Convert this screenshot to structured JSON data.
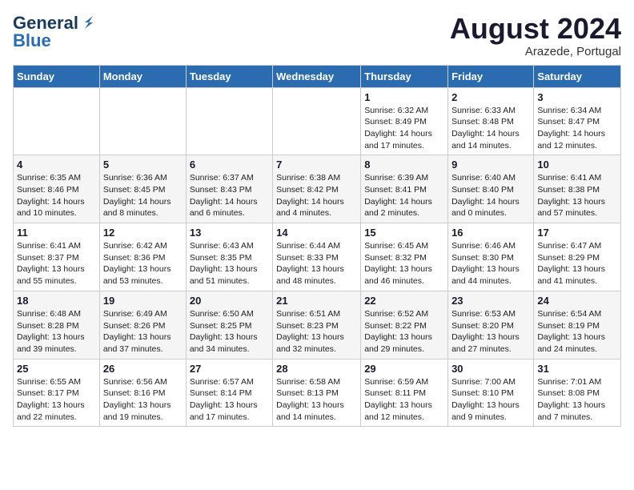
{
  "header": {
    "logo_line1": "General",
    "logo_line2": "Blue",
    "month": "August 2024",
    "location": "Arazede, Portugal"
  },
  "weekdays": [
    "Sunday",
    "Monday",
    "Tuesday",
    "Wednesday",
    "Thursday",
    "Friday",
    "Saturday"
  ],
  "weeks": [
    [
      {
        "day": "",
        "info": ""
      },
      {
        "day": "",
        "info": ""
      },
      {
        "day": "",
        "info": ""
      },
      {
        "day": "",
        "info": ""
      },
      {
        "day": "1",
        "info": "Sunrise: 6:32 AM\nSunset: 8:49 PM\nDaylight: 14 hours\nand 17 minutes."
      },
      {
        "day": "2",
        "info": "Sunrise: 6:33 AM\nSunset: 8:48 PM\nDaylight: 14 hours\nand 14 minutes."
      },
      {
        "day": "3",
        "info": "Sunrise: 6:34 AM\nSunset: 8:47 PM\nDaylight: 14 hours\nand 12 minutes."
      }
    ],
    [
      {
        "day": "4",
        "info": "Sunrise: 6:35 AM\nSunset: 8:46 PM\nDaylight: 14 hours\nand 10 minutes."
      },
      {
        "day": "5",
        "info": "Sunrise: 6:36 AM\nSunset: 8:45 PM\nDaylight: 14 hours\nand 8 minutes."
      },
      {
        "day": "6",
        "info": "Sunrise: 6:37 AM\nSunset: 8:43 PM\nDaylight: 14 hours\nand 6 minutes."
      },
      {
        "day": "7",
        "info": "Sunrise: 6:38 AM\nSunset: 8:42 PM\nDaylight: 14 hours\nand 4 minutes."
      },
      {
        "day": "8",
        "info": "Sunrise: 6:39 AM\nSunset: 8:41 PM\nDaylight: 14 hours\nand 2 minutes."
      },
      {
        "day": "9",
        "info": "Sunrise: 6:40 AM\nSunset: 8:40 PM\nDaylight: 14 hours\nand 0 minutes."
      },
      {
        "day": "10",
        "info": "Sunrise: 6:41 AM\nSunset: 8:38 PM\nDaylight: 13 hours\nand 57 minutes."
      }
    ],
    [
      {
        "day": "11",
        "info": "Sunrise: 6:41 AM\nSunset: 8:37 PM\nDaylight: 13 hours\nand 55 minutes."
      },
      {
        "day": "12",
        "info": "Sunrise: 6:42 AM\nSunset: 8:36 PM\nDaylight: 13 hours\nand 53 minutes."
      },
      {
        "day": "13",
        "info": "Sunrise: 6:43 AM\nSunset: 8:35 PM\nDaylight: 13 hours\nand 51 minutes."
      },
      {
        "day": "14",
        "info": "Sunrise: 6:44 AM\nSunset: 8:33 PM\nDaylight: 13 hours\nand 48 minutes."
      },
      {
        "day": "15",
        "info": "Sunrise: 6:45 AM\nSunset: 8:32 PM\nDaylight: 13 hours\nand 46 minutes."
      },
      {
        "day": "16",
        "info": "Sunrise: 6:46 AM\nSunset: 8:30 PM\nDaylight: 13 hours\nand 44 minutes."
      },
      {
        "day": "17",
        "info": "Sunrise: 6:47 AM\nSunset: 8:29 PM\nDaylight: 13 hours\nand 41 minutes."
      }
    ],
    [
      {
        "day": "18",
        "info": "Sunrise: 6:48 AM\nSunset: 8:28 PM\nDaylight: 13 hours\nand 39 minutes."
      },
      {
        "day": "19",
        "info": "Sunrise: 6:49 AM\nSunset: 8:26 PM\nDaylight: 13 hours\nand 37 minutes."
      },
      {
        "day": "20",
        "info": "Sunrise: 6:50 AM\nSunset: 8:25 PM\nDaylight: 13 hours\nand 34 minutes."
      },
      {
        "day": "21",
        "info": "Sunrise: 6:51 AM\nSunset: 8:23 PM\nDaylight: 13 hours\nand 32 minutes."
      },
      {
        "day": "22",
        "info": "Sunrise: 6:52 AM\nSunset: 8:22 PM\nDaylight: 13 hours\nand 29 minutes."
      },
      {
        "day": "23",
        "info": "Sunrise: 6:53 AM\nSunset: 8:20 PM\nDaylight: 13 hours\nand 27 minutes."
      },
      {
        "day": "24",
        "info": "Sunrise: 6:54 AM\nSunset: 8:19 PM\nDaylight: 13 hours\nand 24 minutes."
      }
    ],
    [
      {
        "day": "25",
        "info": "Sunrise: 6:55 AM\nSunset: 8:17 PM\nDaylight: 13 hours\nand 22 minutes."
      },
      {
        "day": "26",
        "info": "Sunrise: 6:56 AM\nSunset: 8:16 PM\nDaylight: 13 hours\nand 19 minutes."
      },
      {
        "day": "27",
        "info": "Sunrise: 6:57 AM\nSunset: 8:14 PM\nDaylight: 13 hours\nand 17 minutes."
      },
      {
        "day": "28",
        "info": "Sunrise: 6:58 AM\nSunset: 8:13 PM\nDaylight: 13 hours\nand 14 minutes."
      },
      {
        "day": "29",
        "info": "Sunrise: 6:59 AM\nSunset: 8:11 PM\nDaylight: 13 hours\nand 12 minutes."
      },
      {
        "day": "30",
        "info": "Sunrise: 7:00 AM\nSunset: 8:10 PM\nDaylight: 13 hours\nand 9 minutes."
      },
      {
        "day": "31",
        "info": "Sunrise: 7:01 AM\nSunset: 8:08 PM\nDaylight: 13 hours\nand 7 minutes."
      }
    ]
  ]
}
